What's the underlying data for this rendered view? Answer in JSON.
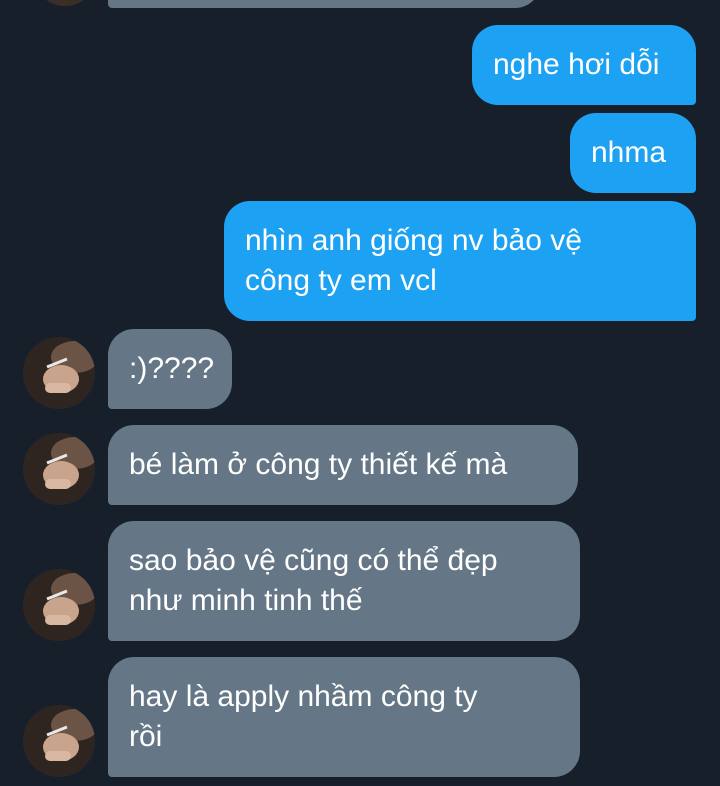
{
  "conversation": {
    "messages": [
      {
        "direction": "outgoing",
        "text": "nghe hơi dỗi"
      },
      {
        "direction": "outgoing",
        "text": "nhma"
      },
      {
        "direction": "outgoing",
        "text": "nhìn anh giống nv bảo vệ\ncông ty em vcl"
      },
      {
        "direction": "incoming",
        "text": ":)????"
      },
      {
        "direction": "incoming",
        "text": "bé làm ở công ty thiết kế mà"
      },
      {
        "direction": "incoming",
        "text": "sao bảo vệ cũng có thể đẹp\nnhư minh tinh thế"
      },
      {
        "direction": "incoming",
        "text": "hay là apply nhầm công ty\nrồi"
      }
    ]
  },
  "colors": {
    "background": "#17202a",
    "outgoing_bubble": "#1da1f2",
    "incoming_bubble": "#657786",
    "text": "#ffffff"
  },
  "icons": {
    "sender_avatar": "profile-photo-avatar"
  }
}
